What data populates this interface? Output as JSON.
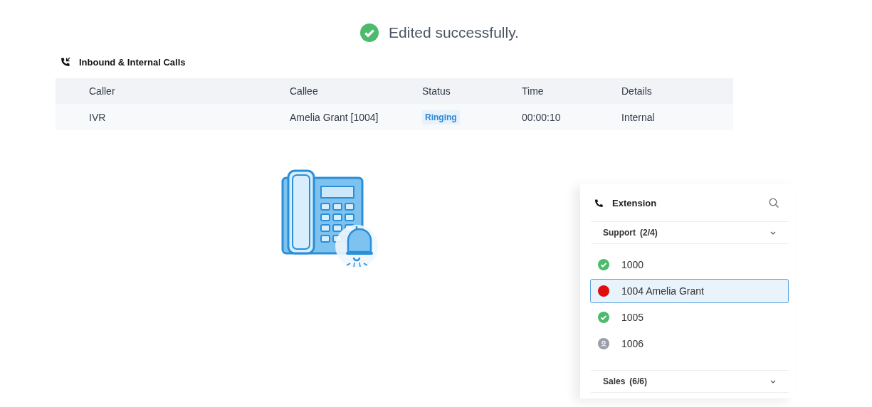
{
  "toast": {
    "message": "Edited successfully."
  },
  "calls": {
    "title": "Inbound & Internal Calls",
    "columns": [
      "Caller",
      "Callee",
      "Status",
      "Time",
      "Details"
    ],
    "rows": [
      {
        "caller": "IVR",
        "callee": "Amelia Grant [1004]",
        "status": "Ringing",
        "time": "00:00:10",
        "details": "Internal"
      }
    ]
  },
  "extension": {
    "title": "Extension",
    "groups": [
      {
        "name": "Support",
        "count": "(2/4)",
        "expanded": true,
        "items": [
          {
            "label": "1000",
            "kind": "available",
            "selected": false
          },
          {
            "label": "1004 Amelia Grant",
            "kind": "busy",
            "selected": true
          },
          {
            "label": "1005",
            "kind": "available",
            "selected": false
          },
          {
            "label": "1006",
            "kind": "offline",
            "selected": false
          }
        ]
      },
      {
        "name": "Sales",
        "count": "(6/6)",
        "expanded": false
      }
    ]
  }
}
